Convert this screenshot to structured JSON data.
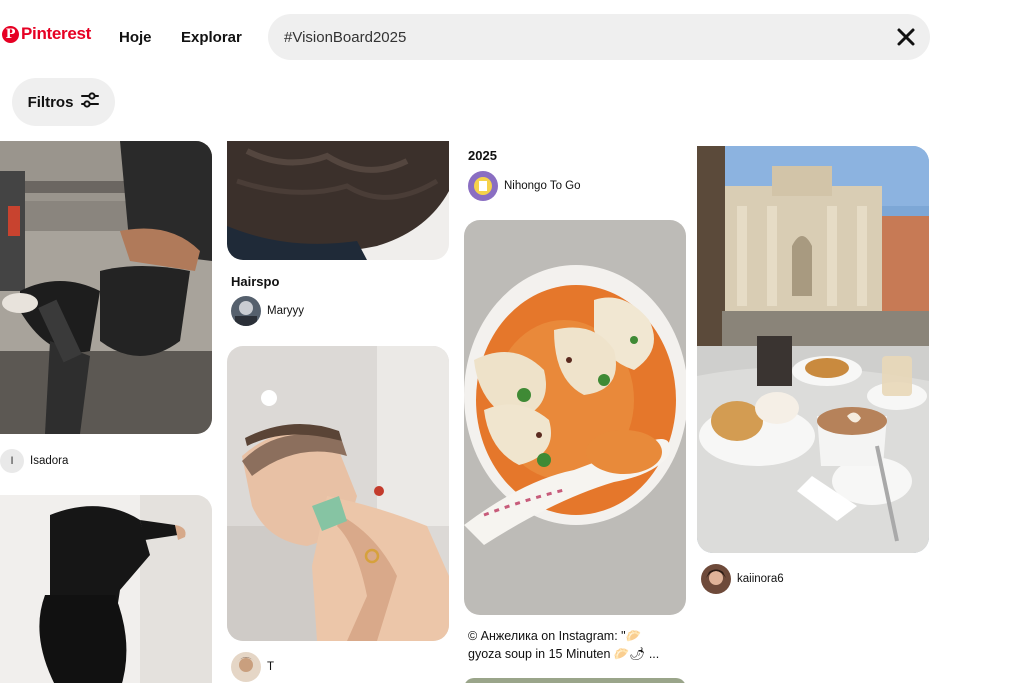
{
  "header": {
    "logo_mark": "P",
    "logo_text": "Pinterest",
    "nav": {
      "hoje": "Hoje",
      "explorar": "Explorar"
    },
    "search": {
      "value": "#VisionBoard2025",
      "clear_icon": "close-icon"
    },
    "filter": {
      "label": "Filtros",
      "icon": "sliders-icon"
    }
  },
  "colors": {
    "brand": "#e60023",
    "search_bg": "#efefef",
    "chip_bg": "#efefef"
  },
  "pins": {
    "col1": {
      "gym": {
        "author_initial": "I",
        "author": "Isadora"
      }
    },
    "col2": {
      "hair": {
        "title": "Hairspo",
        "author": "Maryyy"
      },
      "selfcare": {
        "author": "T"
      }
    },
    "col3": {
      "top": {
        "title": "2025",
        "author": "Nihongo To Go"
      },
      "soup": {
        "description_line1": "© Анжелика on Instagram: \"🥟",
        "description_line2": "gyoza soup in 15 Minuten 🥟🌶 ..."
      }
    },
    "col4": {
      "rome": {
        "author": "kaiinora6"
      }
    }
  }
}
